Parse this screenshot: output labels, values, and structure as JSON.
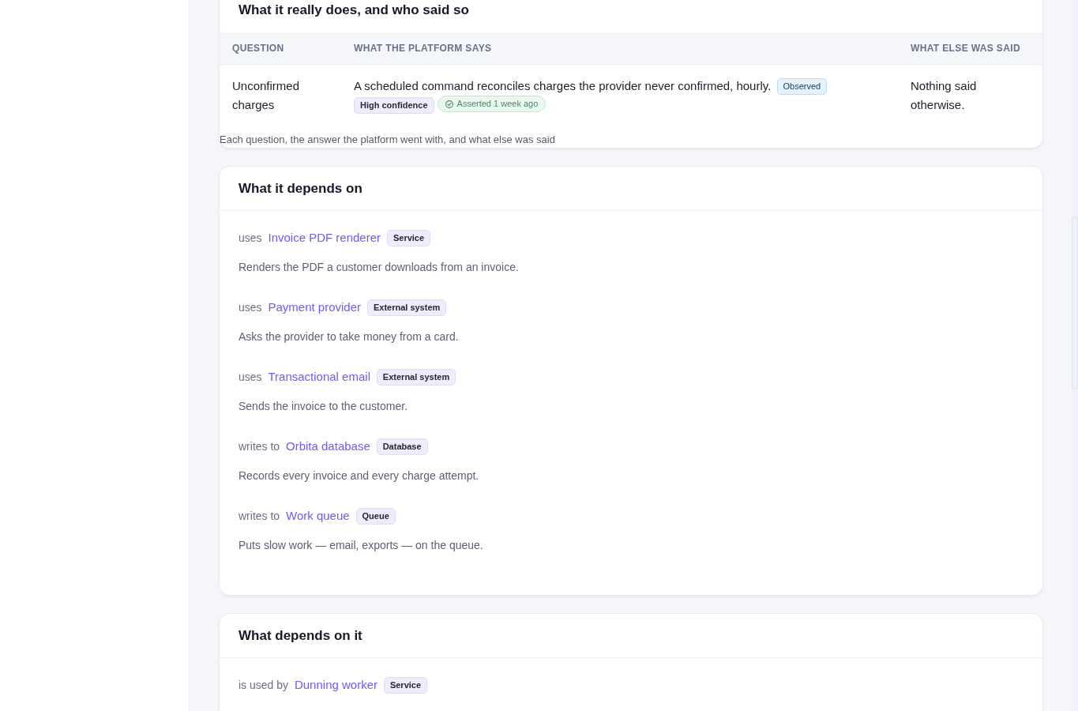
{
  "claims_section": {
    "title": "What it really does, and who said so",
    "table": {
      "columns": [
        "QUESTION",
        "WHAT THE PLATFORM SAYS",
        "WHAT ELSE WAS SAID"
      ],
      "rows": [
        {
          "question": "Unconfirmed charges",
          "answer": {
            "text": "A scheduled command reconciles charges the provider never confirmed, hourly.",
            "evidence": "Observed",
            "confidence": "High confidence",
            "status": "Asserted 1 week ago"
          },
          "other": "Nothing said otherwise."
        }
      ],
      "caption": "Each question, the answer the platform went with, and what else was said"
    }
  },
  "dependencies": {
    "title": "What it depends on",
    "items": [
      {
        "relation": "uses",
        "name": "Invoice PDF renderer",
        "type": "Service",
        "description": "Renders the PDF a customer downloads from an invoice."
      },
      {
        "relation": "uses",
        "name": "Payment provider",
        "type": "External system",
        "description": "Asks the provider to take money from a card."
      },
      {
        "relation": "uses",
        "name": "Transactional email",
        "type": "External system",
        "description": "Sends the invoice to the customer."
      },
      {
        "relation": "writes to",
        "name": "Orbita database",
        "type": "Database",
        "description": "Records every invoice and every charge attempt."
      },
      {
        "relation": "writes to",
        "name": "Work queue",
        "type": "Queue",
        "description": "Puts slow work — email, exports — on the queue."
      }
    ]
  },
  "dependents": {
    "title": "What depends on it",
    "items": [
      {
        "relation": "is used by",
        "name": "Dunning worker",
        "type": "Service"
      }
    ]
  }
}
